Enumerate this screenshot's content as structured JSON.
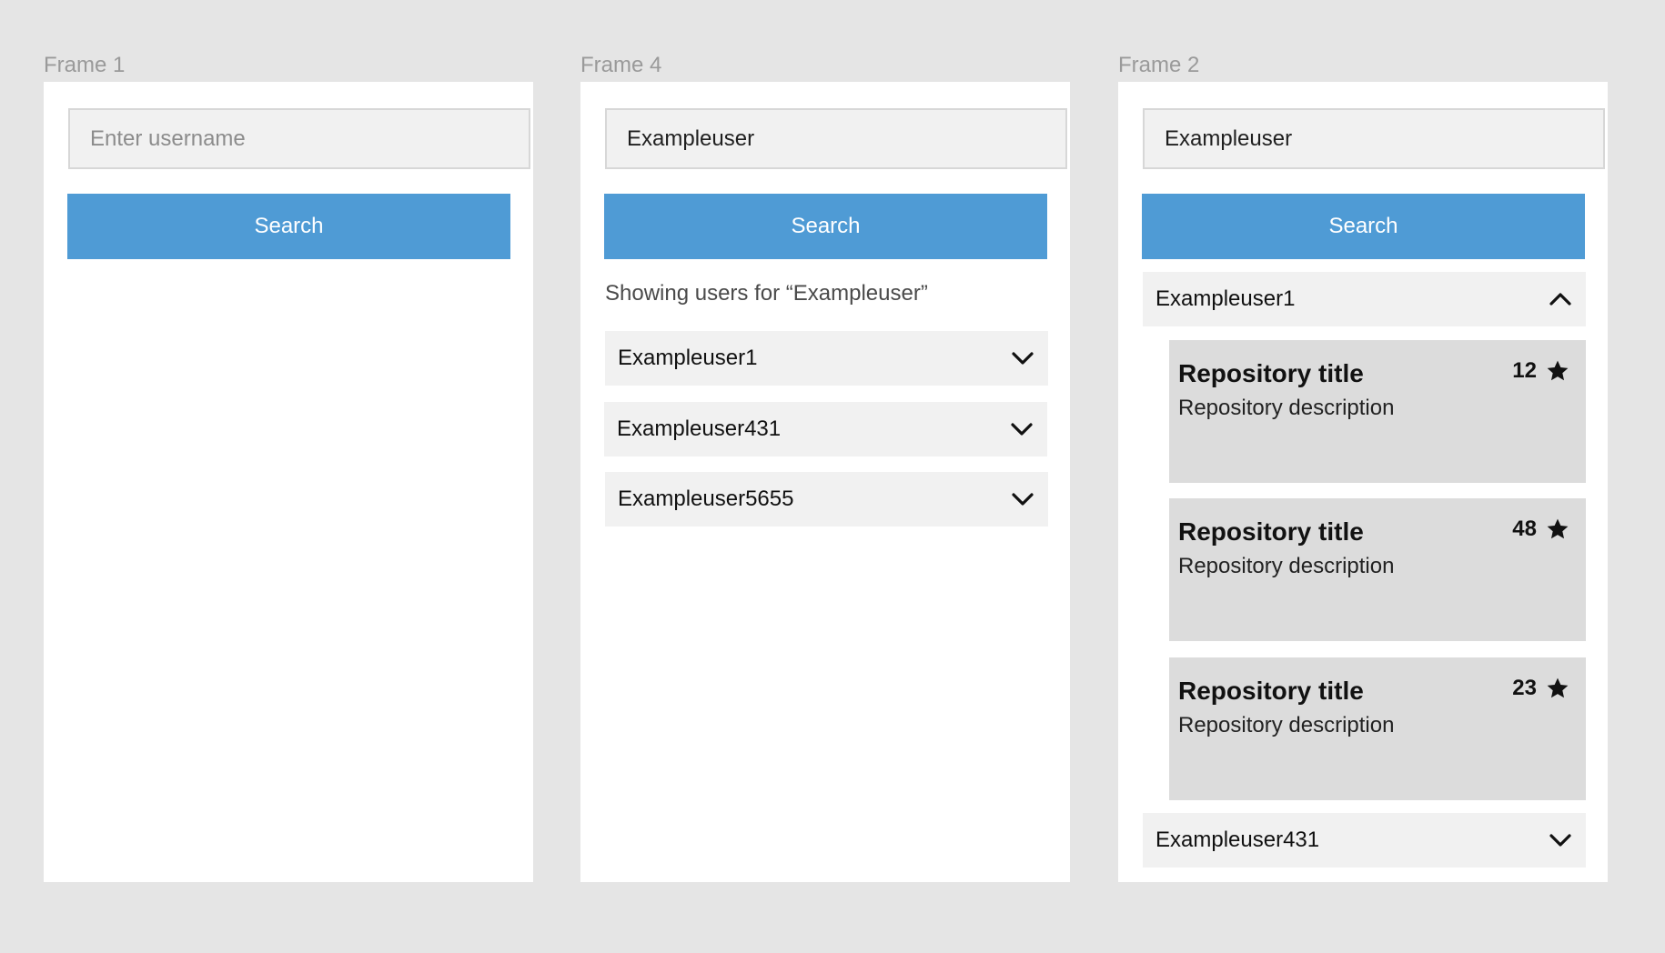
{
  "frames": [
    {
      "label": "Frame 1",
      "input": {
        "value": "",
        "placeholder": "Enter username"
      },
      "search_label": "Search"
    },
    {
      "label": "Frame 4",
      "input": {
        "value": "Exampleuser",
        "placeholder": ""
      },
      "search_label": "Search",
      "caption": "Showing users for “Exampleuser”",
      "users": [
        {
          "name": "Exampleuser1",
          "expanded": false
        },
        {
          "name": "Exampleuser431",
          "expanded": false
        },
        {
          "name": "Exampleuser5655",
          "expanded": false
        }
      ]
    },
    {
      "label": "Frame 2",
      "input": {
        "value": "Exampleuser",
        "placeholder": ""
      },
      "search_label": "Search",
      "users": [
        {
          "name": "Exampleuser1",
          "expanded": true,
          "repos": [
            {
              "title": "Repository title",
              "description": "Repository description",
              "stars": "12"
            },
            {
              "title": "Repository title",
              "description": "Repository description",
              "stars": "48"
            },
            {
              "title": "Repository title",
              "description": "Repository description",
              "stars": "23"
            }
          ]
        },
        {
          "name": "Exampleuser431",
          "expanded": false
        }
      ]
    }
  ],
  "icons": {
    "expand": "chevron-down-icon",
    "collapse": "chevron-up-icon",
    "star": "star-icon"
  },
  "colors": {
    "background": "#e5e5e5",
    "frame": "#ffffff",
    "button": "#4f9bd5",
    "input_bg": "#f1f1f1",
    "card_bg": "#dcdcdc"
  }
}
